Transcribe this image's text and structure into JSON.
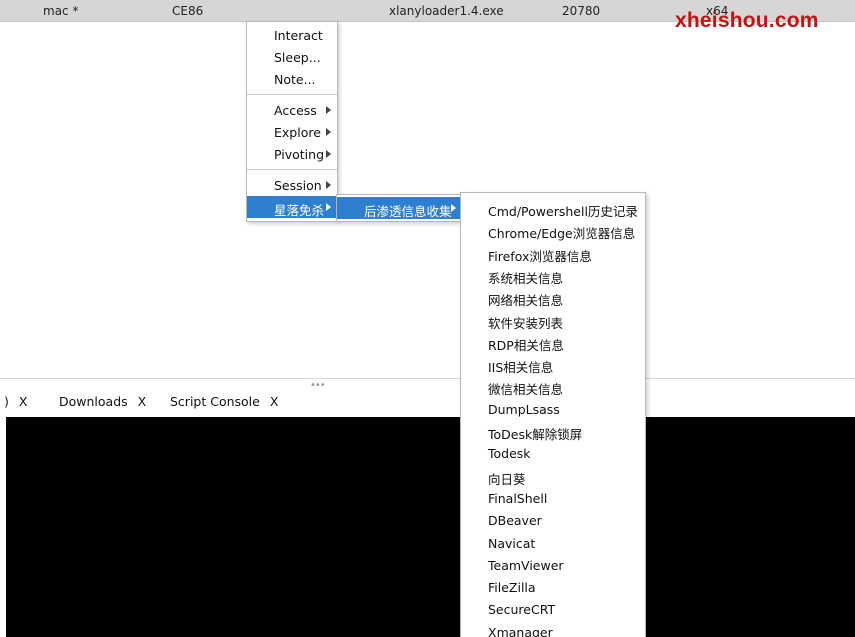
{
  "table_row": {
    "user": "mac *",
    "computer": "CE86",
    "process": "xlanyloader1.4.exe",
    "pid": "20780",
    "arch": "x64"
  },
  "watermark": "xheishou.com",
  "context_menu": {
    "group1": [
      "Interact",
      "Sleep...",
      "Note..."
    ],
    "group2": [
      {
        "label": "Access",
        "submenu": true
      },
      {
        "label": "Explore",
        "submenu": true
      },
      {
        "label": "Pivoting",
        "submenu": true
      }
    ],
    "group3": [
      {
        "label": "Session",
        "submenu": true
      },
      {
        "label": "星落免杀",
        "submenu": true,
        "active": true
      }
    ]
  },
  "submenu": {
    "item": {
      "label": "后渗透信息收集",
      "submenu": true,
      "active": true
    }
  },
  "submenu2": {
    "items": [
      "Cmd/Powershell历史记录",
      "Chrome/Edge浏览器信息",
      "Firefox浏览器信息",
      "系统相关信息",
      "网络相关信息",
      "软件安装列表",
      "RDP相关信息",
      "IIS相关信息",
      "微信相关信息",
      "DumpLsass",
      "ToDesk解除锁屏",
      "Todesk",
      "向日葵",
      "FinalShell",
      "DBeaver",
      "Navicat",
      "TeamViewer",
      "FileZilla",
      "SecureCRT",
      "Xmanager"
    ]
  },
  "tabs": {
    "partial_label": ")",
    "close": "X",
    "downloads": "Downloads",
    "script_console": "Script Console"
  },
  "colors": {
    "highlight": "#2f7fd1",
    "watermark": "#c81010",
    "console_bg": "#000000"
  }
}
